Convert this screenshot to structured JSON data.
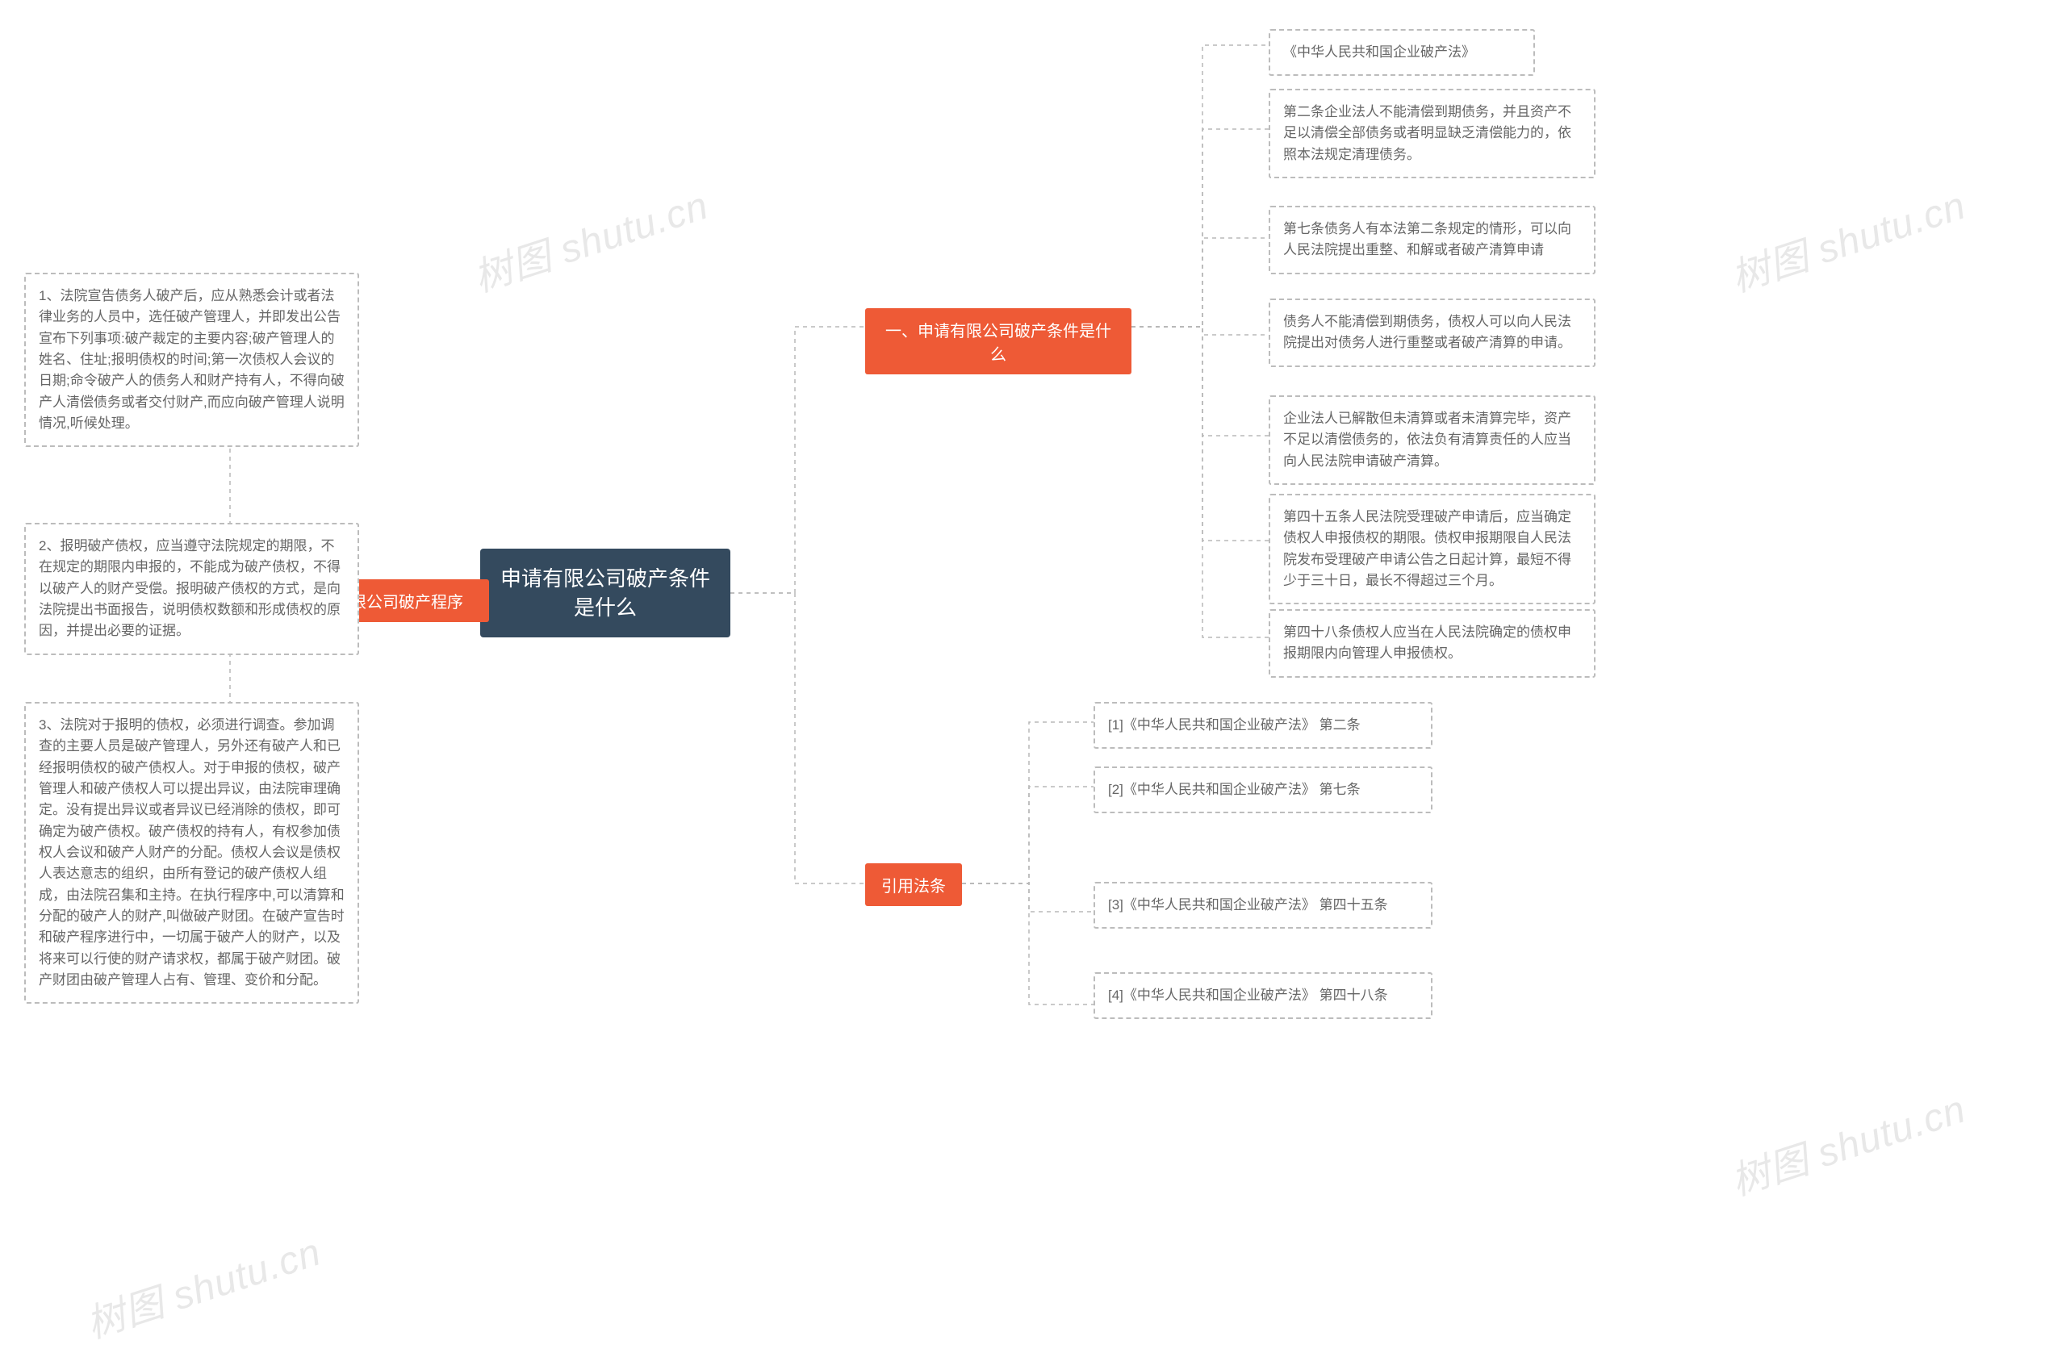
{
  "watermark": "树图 shutu.cn",
  "center": {
    "title": "申请有限公司破产条件是什么"
  },
  "branches": {
    "b1": {
      "label": "一、申请有限公司破产条件是什么",
      "leaves": [
        "《中华人民共和国企业破产法》",
        "第二条企业法人不能清偿到期债务，并且资产不足以清偿全部债务或者明显缺乏清偿能力的，依照本法规定清理债务。",
        "第七条债务人有本法第二条规定的情形，可以向人民法院提出重整、和解或者破产清算申请",
        "债务人不能清偿到期债务，债权人可以向人民法院提出对债务人进行重整或者破产清算的申请。",
        "企业法人已解散但未清算或者未清算完毕，资产不足以清偿债务的，依法负有清算责任的人应当向人民法院申请破产清算。",
        "第四十五条人民法院受理破产申请后，应当确定债权人申报债权的期限。债权申报期限自人民法院发布受理破产申请公告之日起计算，最短不得少于三十日，最长不得超过三个月。",
        "第四十八条债权人应当在人民法院确定的债权申报期限内向管理人申报债权。"
      ]
    },
    "b2": {
      "label": "二、有限公司破产程序",
      "leaves": [
        "1、法院宣告债务人破产后，应从熟悉会计或者法律业务的人员中，选任破产管理人，并即发出公告宣布下列事项:破产裁定的主要内容;破产管理人的姓名、住址;报明债权的时间;第一次债权人会议的日期;命令破产人的债务人和财产持有人，不得向破产人清偿债务或者交付财产,而应向破产管理人说明情况,听候处理。",
        "2、报明破产债权，应当遵守法院规定的期限，不在规定的期限内申报的，不能成为破产债权，不得以破产人的财产受偿。报明破产债权的方式，是向法院提出书面报告，说明债权数额和形成债权的原因，并提出必要的证据。",
        "3、法院对于报明的债权，必须进行调查。参加调查的主要人员是破产管理人，另外还有破产人和已经报明债权的破产债权人。对于申报的债权，破产管理人和破产债权人可以提出异议，由法院审理确定。没有提出异议或者异议已经消除的债权，即可确定为破产债权。破产债权的持有人，有权参加债权人会议和破产人财产的分配。债权人会议是债权人表达意志的组织，由所有登记的破产债权人组成，由法院召集和主持。在执行程序中,可以清算和分配的破产人的财产,叫做破产财团。在破产宣告时和破产程序进行中，一切属于破产人的财产，以及将来可以行使的财产请求权，都属于破产财团。破产财团由破产管理人占有、管理、变价和分配。"
      ]
    },
    "b3": {
      "label": "引用法条",
      "leaves": [
        "[1]《中华人民共和国企业破产法》 第二条",
        "[2]《中华人民共和国企业破产法》 第七条",
        "[3]《中华人民共和国企业破产法》 第四十五条",
        "[4]《中华人民共和国企业破产法》 第四十八条"
      ]
    }
  }
}
